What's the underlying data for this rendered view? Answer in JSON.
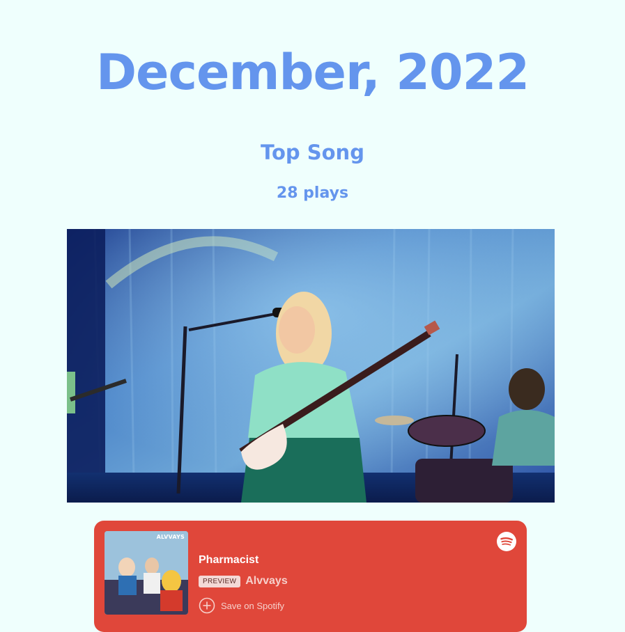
{
  "header": {
    "title": "December, 2022"
  },
  "top_song": {
    "section_title": "Top Song",
    "plays": "28 plays"
  },
  "video": {
    "icon": "video-thumbnail"
  },
  "spotify_embed": {
    "track_title": "Pharmacist",
    "preview_badge": "PREVIEW",
    "artist": "Alvvays",
    "save_label": "Save on Spotify",
    "album_label": "ALVVAYS",
    "card_color": "#e0473a",
    "logo_icon": "spotify-icon",
    "save_icon": "plus-circle-icon"
  },
  "colors": {
    "background": "#effffd",
    "accent": "#6495ed"
  }
}
